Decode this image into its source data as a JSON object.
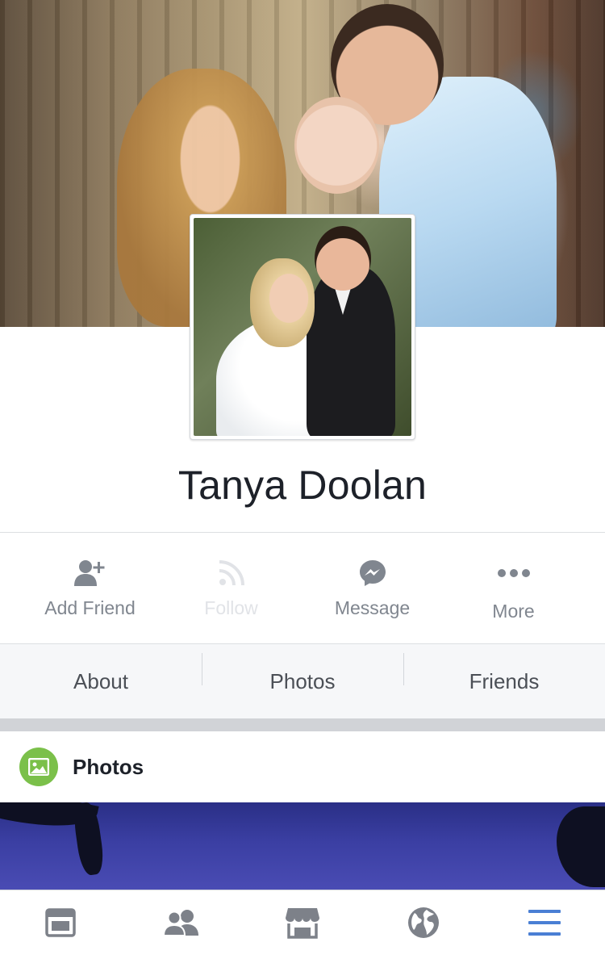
{
  "profile": {
    "name": "Tanya Doolan"
  },
  "actions": [
    {
      "label": "Add Friend",
      "icon": "add-friend-icon",
      "enabled": true
    },
    {
      "label": "Follow",
      "icon": "rss-follow-icon",
      "enabled": false
    },
    {
      "label": "Message",
      "icon": "messenger-icon",
      "enabled": true
    },
    {
      "label": "More",
      "icon": "more-dots-icon",
      "enabled": true
    }
  ],
  "tabs": [
    {
      "label": "About"
    },
    {
      "label": "Photos"
    },
    {
      "label": "Friends"
    }
  ],
  "photos_section": {
    "title": "Photos",
    "icon": "photo-icon"
  },
  "bottom_bar": [
    {
      "icon": "news-feed-icon"
    },
    {
      "icon": "friend-requests-icon"
    },
    {
      "icon": "marketplace-icon"
    },
    {
      "icon": "notifications-globe-icon"
    },
    {
      "icon": "menu-icon",
      "active": true
    }
  ],
  "colors": {
    "accent": "#4a7fd4",
    "text_primary": "#1d2129",
    "text_secondary": "#80868f",
    "disabled": "#e1e3e7",
    "photos_icon_bg": "#7bc04a",
    "tab_bg": "#f6f7f9"
  }
}
